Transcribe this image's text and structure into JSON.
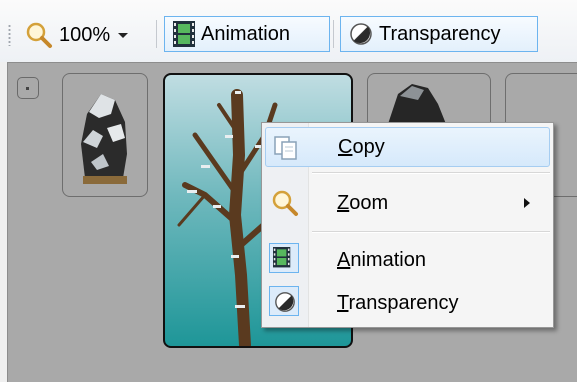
{
  "toolbar": {
    "zoom_value": "100%",
    "animation_label": "Animation",
    "transparency_label": "Transparency"
  },
  "context_menu": {
    "items": [
      {
        "label": "Copy",
        "mnemonic": "C",
        "icon": "copy-icon",
        "highlighted": true
      },
      {
        "label": "Zoom",
        "mnemonic": "Z",
        "icon": "magnifier-icon",
        "has_submenu": true
      },
      {
        "label": "Animation",
        "mnemonic": "A",
        "icon": "film-icon",
        "checked": true
      },
      {
        "label": "Transparency",
        "mnemonic": "T",
        "icon": "transparency-icon",
        "checked": true
      }
    ]
  },
  "colors": {
    "accent": "#6cb4ef",
    "selected_tile_top": "#c0dde2",
    "selected_tile_bottom": "#1e9698",
    "canvas": "#a9a9a9"
  }
}
